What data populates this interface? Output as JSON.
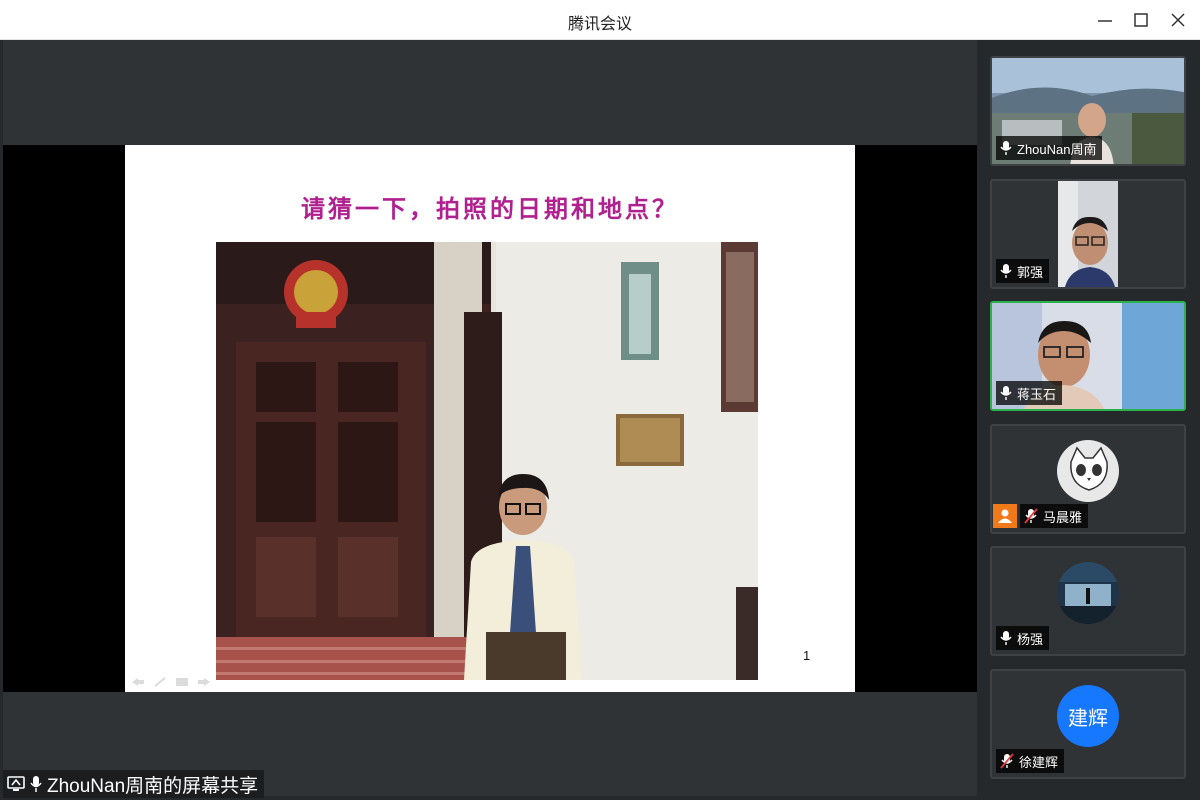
{
  "window": {
    "title": "腾讯会议"
  },
  "slide": {
    "title": "请猜一下，拍照的日期和地点？",
    "page_number": "1"
  },
  "share_bar": {
    "label": "ZhouNan周南的屏幕共享"
  },
  "participants": [
    {
      "name": "ZhouNan周南",
      "mic": "mic-icon",
      "video": true
    },
    {
      "name": "郭强",
      "mic": "mic-icon",
      "video": true
    },
    {
      "name": "蒋玉石",
      "mic": "mic-icon",
      "video": true,
      "speaking": true
    },
    {
      "name": "马晨雅",
      "mic": "mic-muted-icon",
      "video": false,
      "avatar": "cat-avatar"
    },
    {
      "name": "杨强",
      "mic": "mic-icon",
      "video": false,
      "avatar": "photo-avatar"
    },
    {
      "name": "徐建辉",
      "mic": "mic-muted-icon",
      "video": false,
      "avatar_text": "建辉",
      "avatar_color": "#1677ff"
    }
  ],
  "colors": {
    "title_magenta": "#b0208f",
    "speaking_border": "#2bb24c",
    "avatar_blue": "#1677ff"
  }
}
